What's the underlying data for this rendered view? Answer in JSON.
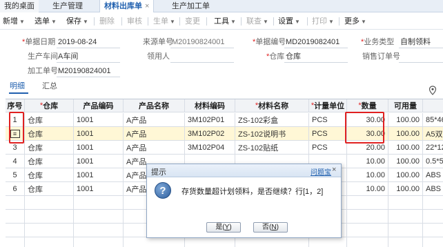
{
  "tabs": [
    {
      "label": "我的桌面"
    },
    {
      "label": "生产管理"
    },
    {
      "label": "材料出库单",
      "close": "×"
    },
    {
      "label": "生产加工单"
    }
  ],
  "toolbar": {
    "new": "新增",
    "pick": "选单",
    "save": "保存",
    "delete": "删除",
    "audit": "审核",
    "generate": "生单",
    "change": "变更",
    "tools": "工具",
    "inquiry": "联查",
    "settings": "设置",
    "print": "打印",
    "more": "更多"
  },
  "form": {
    "date_label": "单据日期",
    "date_value": "2019-08-24",
    "source_label": "来源单号",
    "source_value": "M20190824001",
    "doc_no_label": "单据编号",
    "doc_no_value": "MD2019082401",
    "biz_type_label": "业务类型",
    "biz_type_value": "自制领料",
    "workshop_label": "生产车间",
    "workshop_value": "A车间",
    "picker_label": "领用人",
    "picker_value": "",
    "warehouse_label": "仓库",
    "warehouse_value": "仓库",
    "sales_order_label": "销售订单号",
    "sales_order_value": "",
    "process_no_label": "加工单号",
    "process_no_value": "M20190824001"
  },
  "subtabs": {
    "detail": "明细",
    "summary": "汇总"
  },
  "grid": {
    "headers": {
      "seq": "序号",
      "warehouse": "仓库",
      "product_code": "产品编码",
      "product_name": "产品名称",
      "material_code": "材料编码",
      "material_name": "材料名称",
      "unit": "计量单位",
      "qty": "数量",
      "available": "可用量",
      "extra": ""
    },
    "rows": [
      {
        "seq": "1",
        "warehouse": "仓库",
        "product_code": "1001",
        "product_name": "A产品",
        "material_code": "3M102P01",
        "material_name": "ZS-102彩盒",
        "unit": "PCS",
        "qty": "30.00",
        "available": "100.00",
        "extra": "85*46*"
      },
      {
        "seq": "2",
        "warehouse": "仓库",
        "product_code": "1001",
        "product_name": "A产品",
        "material_code": "3M102P02",
        "material_name": "ZS-102说明书",
        "unit": "PCS",
        "qty": "30.00",
        "available": "100.00",
        "extra": "A5双面"
      },
      {
        "seq": "3",
        "warehouse": "仓库",
        "product_code": "1001",
        "product_name": "A产品",
        "material_code": "3M102P04",
        "material_name": "ZS-102贴纸",
        "unit": "PCS",
        "qty": "20.00",
        "available": "100.00",
        "extra": "22*12c"
      },
      {
        "seq": "4",
        "warehouse": "仓库",
        "product_code": "1001",
        "product_name": "A产品",
        "material_code": "",
        "material_name": "",
        "unit": "",
        "qty": "10.00",
        "available": "100.00",
        "extra": "0.5*5*"
      },
      {
        "seq": "5",
        "warehouse": "仓库",
        "product_code": "1001",
        "product_name": "A产品",
        "material_code": "",
        "material_name": "",
        "unit": "",
        "qty": "10.00",
        "available": "100.00",
        "extra": "ABS ,"
      },
      {
        "seq": "6",
        "warehouse": "仓库",
        "product_code": "1001",
        "product_name": "A产品",
        "material_code": "",
        "material_name": "",
        "unit": "",
        "qty": "10.00",
        "available": "100.00",
        "extra": "ABS ,"
      }
    ]
  },
  "dialog": {
    "title": "提示",
    "link": "问题宝",
    "close": "×",
    "message": "存货数量超计划领料，是否继续？行[1，2]",
    "yes_label": "是(",
    "yes_key": "Y",
    "no_label": "否(",
    "no_key": "N",
    "paren_close": ")",
    "icon": "question-icon"
  },
  "colors": {
    "accent": "#1f5fae",
    "highlight": "#e02020",
    "selected_row": "#fff7d6"
  }
}
